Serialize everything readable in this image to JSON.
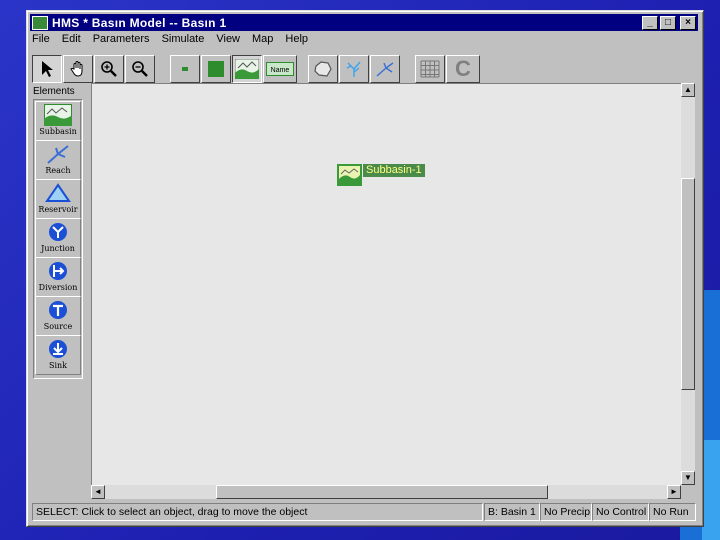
{
  "window": {
    "title": "HMS * Basın Model -- Basın 1",
    "controls": {
      "minimize": "_",
      "maximize": "□",
      "close": "×"
    }
  },
  "menu": [
    "File",
    "Edit",
    "Parameters",
    "Simulate",
    "View",
    "Map",
    "Help"
  ],
  "toolbar": {
    "buttons": [
      {
        "name": "select-tool",
        "icon": "arrow-pointer-icon"
      },
      {
        "name": "pan-tool",
        "icon": "hand-icon"
      },
      {
        "name": "zoom-in-tool",
        "icon": "zoom-in-icon"
      },
      {
        "name": "zoom-out-tool",
        "icon": "zoom-out-icon"
      },
      {
        "name": "small-icon-toggle",
        "icon": "small-square-icon"
      },
      {
        "name": "large-icon-toggle",
        "icon": "large-square-icon"
      },
      {
        "name": "map-icon-toggle",
        "icon": "landscape-icon"
      },
      {
        "name": "name-toggle",
        "icon": "name-label-icon",
        "label": "Name"
      },
      {
        "name": "basin-boundary-toggle",
        "icon": "boundary-icon"
      },
      {
        "name": "stream-network-toggle",
        "icon": "river-network-icon"
      },
      {
        "name": "reach-toggle",
        "icon": "stream-icon"
      },
      {
        "name": "grid-toggle",
        "icon": "grid-icon"
      },
      {
        "name": "compute-button",
        "icon": "c-letter-icon",
        "label": "C"
      }
    ]
  },
  "palette": {
    "title": "Elements",
    "items": [
      {
        "label": "Subbasin",
        "icon": "subbasin-icon"
      },
      {
        "label": "Reach",
        "icon": "reach-icon"
      },
      {
        "label": "Reservoir",
        "icon": "reservoir-triangle-icon"
      },
      {
        "label": "Junction",
        "icon": "junction-icon"
      },
      {
        "label": "Diversion",
        "icon": "diversion-icon"
      },
      {
        "label": "Source",
        "icon": "source-icon"
      },
      {
        "label": "Sink",
        "icon": "sink-icon"
      }
    ]
  },
  "canvas": {
    "nodes": [
      {
        "label": "Subbasin-1",
        "icon": "subbasin-icon",
        "selected": true
      }
    ]
  },
  "scrollbars": {
    "up": "▲",
    "down": "▼",
    "left": "◄",
    "right": "►"
  },
  "status": {
    "message": "SELECT: Click to select an object, drag to move the object",
    "basin": "B: Basin 1",
    "precip": "No Precip",
    "control": "No Control",
    "run": "No Run"
  },
  "colors": {
    "title_bar": "#000080",
    "window_face": "#c0c0c0",
    "canvas": "#e7e7e7",
    "subbasin_green": "#3a9a3a",
    "node_label_text": "#ffff80",
    "desktop": "#1d1fb0"
  }
}
